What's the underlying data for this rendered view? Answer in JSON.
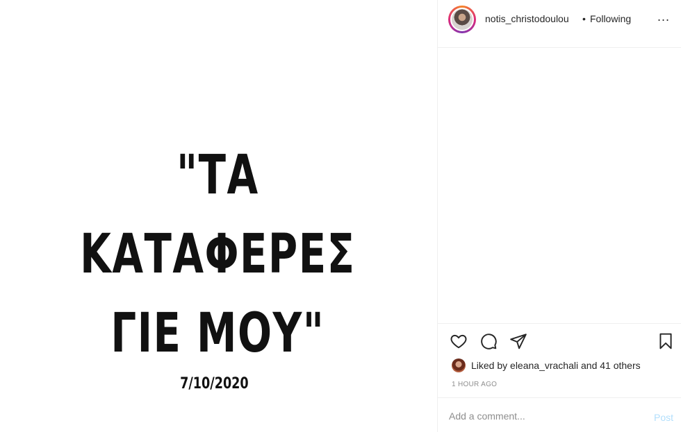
{
  "post": {
    "quote_line1": "\"ΤΑ ΚΑΤΑΦΕΡΕΣ",
    "quote_line2": "ΓΙΕ ΜΟΥ\"",
    "date": "7/10/2020"
  },
  "header": {
    "username": "notis_christodoulou",
    "separator": "•",
    "follow_status": "Following",
    "more_label": "..."
  },
  "actions": {
    "icons": [
      "heart-icon",
      "comment-icon",
      "share-icon",
      "bookmark-icon"
    ]
  },
  "likes": {
    "text": "Liked by eleana_vrachali and 41 others"
  },
  "timestamp": "1 HOUR AGO",
  "comment": {
    "placeholder": "Add a comment...",
    "post_label": "Post"
  },
  "colors": {
    "text": "#262626",
    "muted": "#8e8e8e",
    "post_disabled": "#b2dffc",
    "divider": "#efefef"
  }
}
